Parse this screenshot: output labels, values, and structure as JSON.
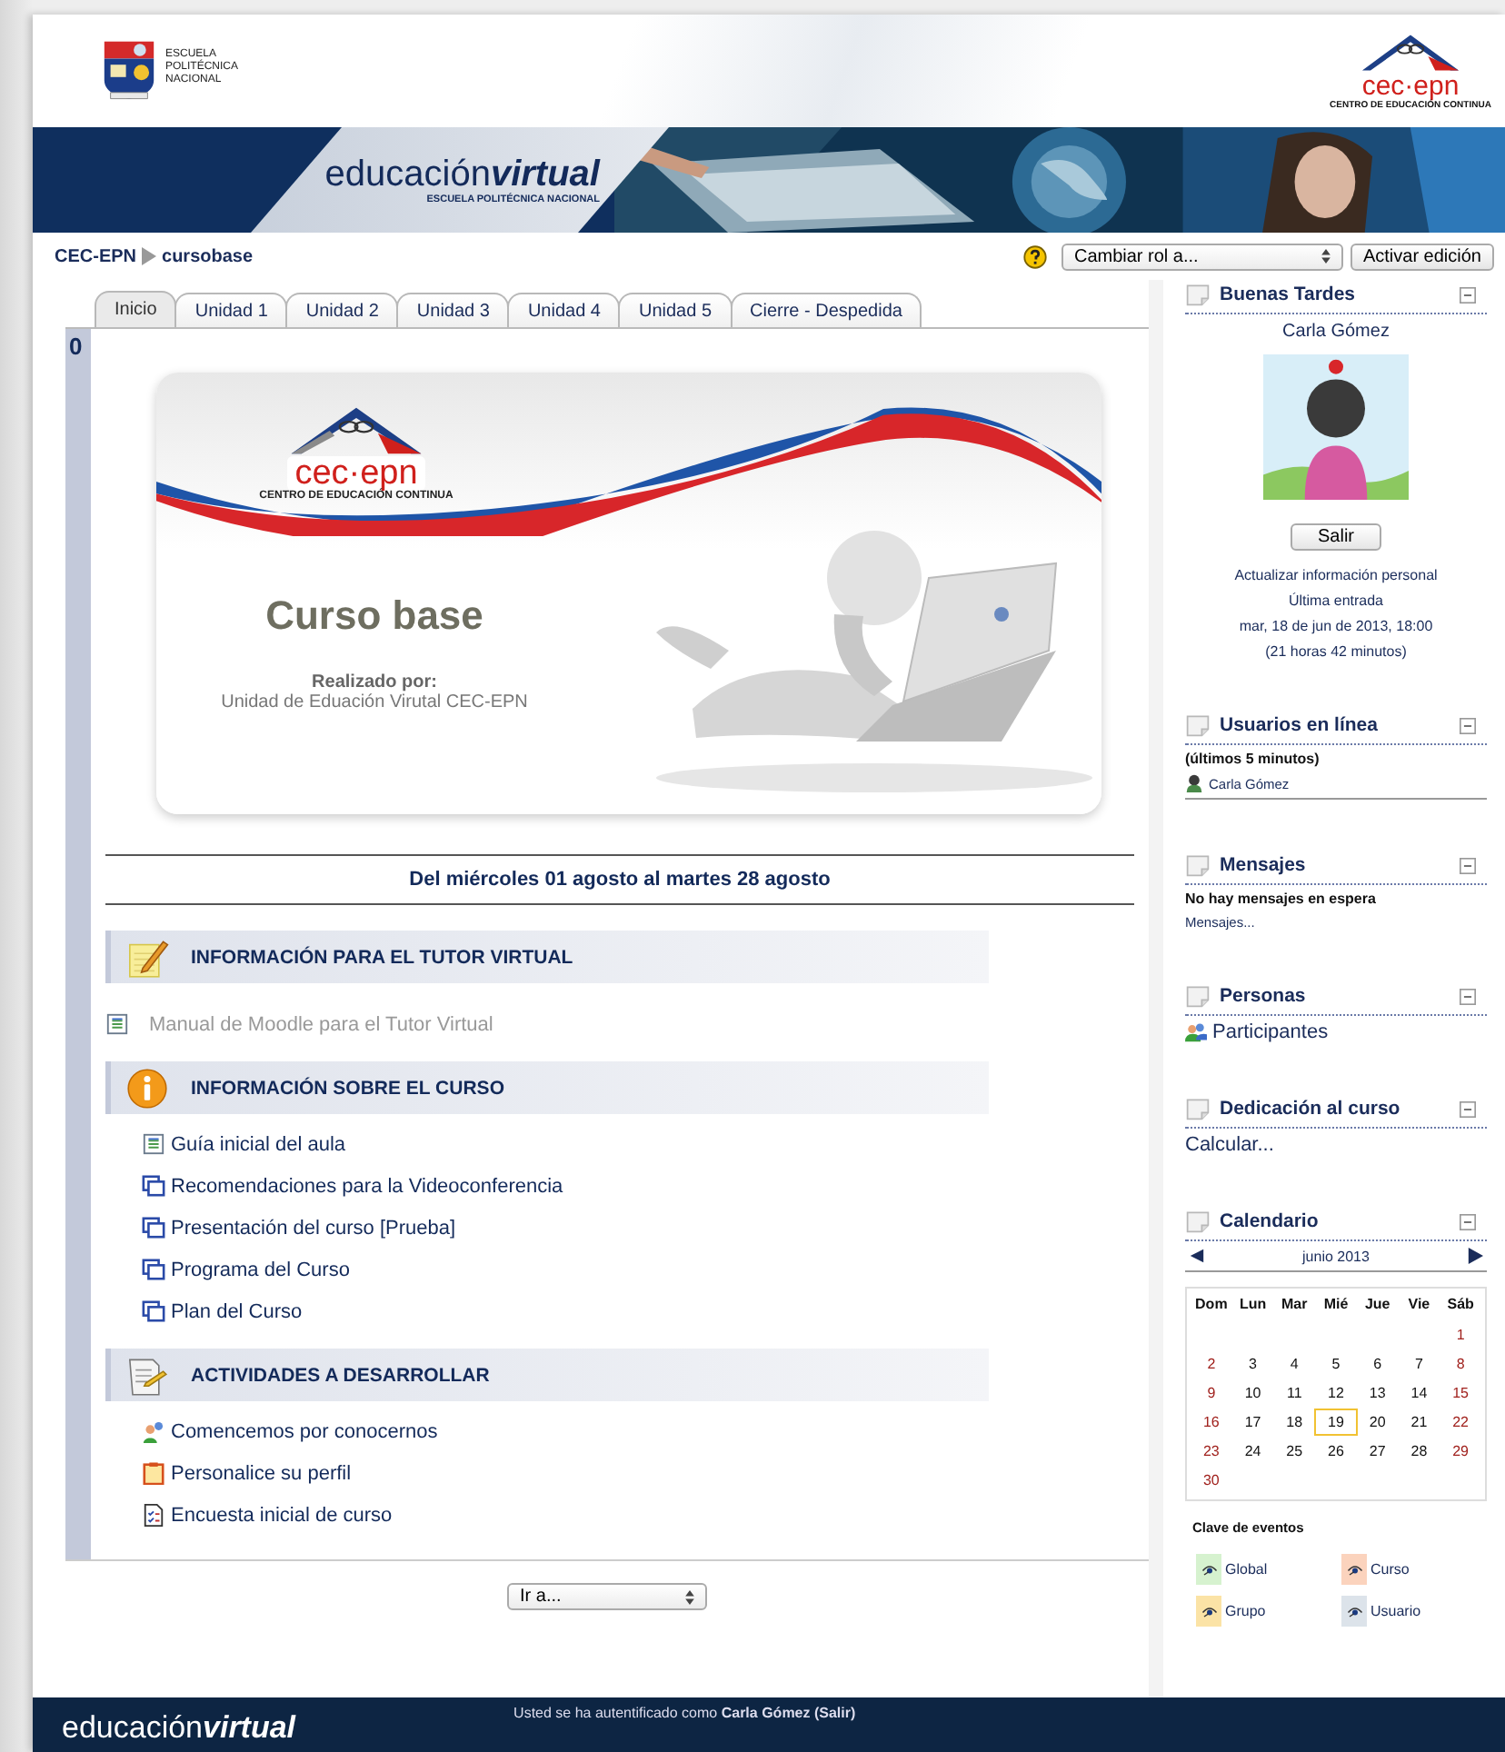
{
  "header": {
    "school_lines": [
      "ESCUELA",
      "POLITÉCNICA",
      "NACIONAL"
    ],
    "cec_logo": {
      "mark": "cec·epn",
      "subtitle": "CENTRO DE EDUCACIÓN CONTINUA"
    },
    "brand": {
      "plain": "educación",
      "bold": "virtual",
      "subtitle": "ESCUELA POLITÉCNICA NACIONAL"
    }
  },
  "breadcrumb": [
    "CEC-EPN",
    "cursobase"
  ],
  "role_select": "Cambiar rol a...",
  "edit_button": "Activar edición",
  "tabs": [
    {
      "label": "Inicio",
      "selected": true
    },
    {
      "label": "Unidad 1",
      "selected": false
    },
    {
      "label": "Unidad 2",
      "selected": false
    },
    {
      "label": "Unidad 3",
      "selected": false
    },
    {
      "label": "Unidad 4",
      "selected": false
    },
    {
      "label": "Unidad 5",
      "selected": false
    },
    {
      "label": "Cierre - Despedida",
      "selected": false
    }
  ],
  "section_number": "0",
  "banner": {
    "logo_mark": "cec·epn",
    "logo_subtitle": "CENTRO DE EDUCACIÓN CONTINUA",
    "title": "Curso base",
    "credit_label": "Realizado por:",
    "credit": "Unidad de Eduación Virutal CEC-EPN"
  },
  "dates": "Del miércoles 01 agosto al martes 28 agosto",
  "sections": [
    {
      "title": "INFORMACIÓN PARA EL TUTOR VIRTUAL",
      "kind": "note",
      "items": [
        {
          "label": "Manual de Moodle para el Tutor Virtual",
          "kind": "page",
          "dimmed": true
        }
      ]
    },
    {
      "title": "INFORMACIÓN SOBRE EL CURSO",
      "kind": "info",
      "items": [
        {
          "label": "Guía inicial del aula",
          "kind": "page",
          "dimmed": false
        },
        {
          "label": "Recomendaciones para la Videoconferencia",
          "kind": "window",
          "dimmed": false
        },
        {
          "label": "Presentación del curso [Prueba]",
          "kind": "window",
          "dimmed": false
        },
        {
          "label": "Programa del Curso",
          "kind": "window",
          "dimmed": false
        },
        {
          "label": "Plan del Curso",
          "kind": "window",
          "dimmed": false
        }
      ]
    },
    {
      "title": "ACTIVIDADES A DESARROLLAR",
      "kind": "doc",
      "items": [
        {
          "label": "Comencemos por conocernos",
          "kind": "people",
          "dimmed": false
        },
        {
          "label": "Personalice su perfil",
          "kind": "clipboard",
          "dimmed": false
        },
        {
          "label": "Encuesta inicial de curso",
          "kind": "checklist",
          "dimmed": false
        }
      ]
    }
  ],
  "jump_select": "Ir a...",
  "blocks": [
    {
      "kind": "user",
      "title": "Buenas Tardes",
      "name": "Carla Gómez",
      "logout": "Salir",
      "update_link": "Actualizar información personal",
      "last_label": "Última entrada",
      "last_date": "mar, 18 de jun de 2013, 18:00",
      "last_ago": "(21 horas 42 minutos)"
    },
    {
      "kind": "online",
      "title": "Usuarios en línea",
      "subtitle": "(últimos 5 minutos)",
      "users": [
        "Carla Gómez"
      ]
    },
    {
      "kind": "messages",
      "title": "Mensajes",
      "status": "No hay mensajes en espera",
      "link": "Mensajes..."
    },
    {
      "kind": "people",
      "title": "Personas",
      "link": "Participantes"
    },
    {
      "kind": "link",
      "title": "Dedicación al curso",
      "link": "Calcular..."
    },
    {
      "kind": "calendar",
      "title": "Calendario",
      "month": "junio 2013",
      "weekdays": [
        "Dom",
        "Lun",
        "Mar",
        "Mié",
        "Jue",
        "Vie",
        "Sáb"
      ],
      "weeks": [
        [
          {
            "d": "1",
            "weekend": true,
            "today": false
          }
        ],
        [
          {
            "d": "2",
            "weekend": true,
            "today": false
          },
          {
            "d": "3",
            "weekend": false,
            "today": false
          },
          {
            "d": "4",
            "weekend": false,
            "today": false
          },
          {
            "d": "5",
            "weekend": false,
            "today": false
          },
          {
            "d": "6",
            "weekend": false,
            "today": false
          },
          {
            "d": "7",
            "weekend": false,
            "today": false
          },
          {
            "d": "8",
            "weekend": true,
            "today": false
          }
        ],
        [
          {
            "d": "9",
            "weekend": true,
            "today": false
          },
          {
            "d": "10",
            "weekend": false,
            "today": false
          },
          {
            "d": "11",
            "weekend": false,
            "today": false
          },
          {
            "d": "12",
            "weekend": false,
            "today": false
          },
          {
            "d": "13",
            "weekend": false,
            "today": false
          },
          {
            "d": "14",
            "weekend": false,
            "today": false
          },
          {
            "d": "15",
            "weekend": true,
            "today": false
          }
        ],
        [
          {
            "d": "16",
            "weekend": true,
            "today": false
          },
          {
            "d": "17",
            "weekend": false,
            "today": false
          },
          {
            "d": "18",
            "weekend": false,
            "today": false
          },
          {
            "d": "19",
            "weekend": false,
            "today": true
          },
          {
            "d": "20",
            "weekend": false,
            "today": false
          },
          {
            "d": "21",
            "weekend": false,
            "today": false
          },
          {
            "d": "22",
            "weekend": true,
            "today": false
          }
        ],
        [
          {
            "d": "23",
            "weekend": true,
            "today": false
          },
          {
            "d": "24",
            "weekend": false,
            "today": false
          },
          {
            "d": "25",
            "weekend": false,
            "today": false
          },
          {
            "d": "26",
            "weekend": false,
            "today": false
          },
          {
            "d": "27",
            "weekend": false,
            "today": false
          },
          {
            "d": "28",
            "weekend": false,
            "today": false
          },
          {
            "d": "29",
            "weekend": true,
            "today": false
          }
        ],
        [
          {
            "d": "30",
            "weekend": true,
            "today": false
          }
        ]
      ],
      "key_title": "Clave de eventos",
      "key": [
        {
          "label": "Global",
          "color": "#d6f2cf"
        },
        {
          "label": "Curso",
          "color": "#fbd3bd"
        },
        {
          "label": "Grupo",
          "color": "#fbe3a6"
        },
        {
          "label": "Usuario",
          "color": "#dce3ea"
        }
      ]
    }
  ],
  "footer": {
    "brand_plain": "educación",
    "brand_bold": "virtual",
    "auth_text": "Usted se ha autentificado como",
    "auth_user": "Carla Gómez",
    "auth_logout": "(Salir)"
  }
}
